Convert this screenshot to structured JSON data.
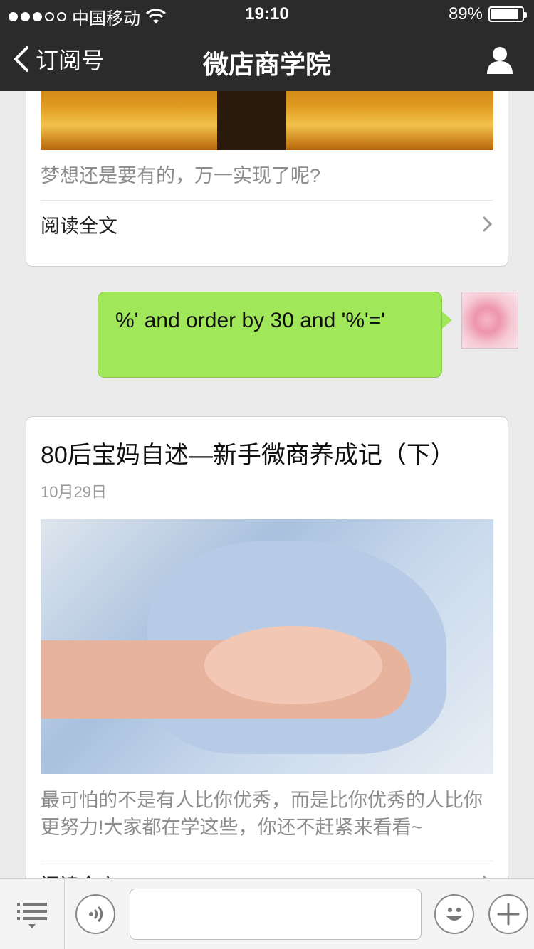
{
  "status_bar": {
    "carrier": "中国移动",
    "time": "19:10",
    "battery": "89%",
    "battery_level": 0.89
  },
  "nav": {
    "back_label": "订阅号",
    "title": "微店商学院"
  },
  "card1": {
    "description": "梦想还是要有的，万一实现了呢?",
    "read_more": "阅读全文"
  },
  "message": {
    "text": "%' and order by 30 and '%'='"
  },
  "card2": {
    "headline": "80后宝妈自述—新手微商养成记（下）",
    "date": "10月29日",
    "description": "最可怕的不是有人比你优秀，而是比你优秀的人比你更努力!大家都在学这些，你还不赶紧来看看~",
    "read_more": "阅读全文"
  },
  "input": {
    "placeholder": ""
  },
  "colors": {
    "bubble": "#a0e75a",
    "topbar": "#2b2b2b"
  }
}
